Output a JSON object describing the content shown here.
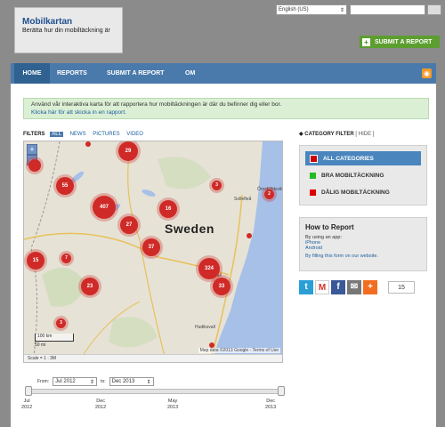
{
  "header": {
    "site_title": "Mobilkartan",
    "tagline": "Berätta hur din mobiltäckning är",
    "language": "English (US)",
    "submit_label": "SUBMIT A REPORT"
  },
  "nav": {
    "items": [
      "HOME",
      "REPORTS",
      "SUBMIT A REPORT",
      "OM"
    ]
  },
  "info": {
    "text": "Använd vår interaktiva karta för att rapportera hur mobiltäckningen är där du befinner dig eller bor.",
    "link": "Klicka här för att skicka in en rapport."
  },
  "filters": {
    "label": "FILTERS",
    "items": [
      "ALL",
      "NEWS",
      "PICTURES",
      "VIDEO"
    ]
  },
  "map": {
    "country_label": "Sweden",
    "clusters": [
      "29",
      "55",
      "407",
      "16",
      "27",
      "37",
      "15",
      "23",
      "324",
      "33"
    ],
    "small_counts": [
      "3",
      "7",
      "3",
      "2",
      "3"
    ],
    "towns": [
      "Sollefteå",
      "Örnsköldsvik",
      "Sundsvall",
      "Hudiksvall"
    ],
    "scale_km": "100 km",
    "scale_mi": "50 mi",
    "scale_ratio": "Scale = 1 : 3M",
    "attribution": "Map data ©2013 Google - Terms of Use"
  },
  "timeline": {
    "from_label": "From:",
    "from_value": "Jul 2012",
    "to_label": "to:",
    "to_value": "Dec 2013",
    "ticks": [
      {
        "month": "Jul",
        "year": "2012"
      },
      {
        "month": "Dec",
        "year": "2012"
      },
      {
        "month": "May",
        "year": "2013"
      },
      {
        "month": "Dec",
        "year": "2013"
      }
    ]
  },
  "sidebar": {
    "category_filter": "CATEGORY FILTER",
    "hide": "HIDE",
    "categories": [
      {
        "label": "ALL CATEGORIES",
        "color": "#cc0000"
      },
      {
        "label": "BRA MOBILTÄCKNING",
        "color": "#22bb22"
      },
      {
        "label": "DÅLIG MOBILTÄCKNING",
        "color": "#dd0000"
      }
    ],
    "howto_title": "How to Report",
    "howto_sub": "By using an app:",
    "howto_links": [
      "iPhone",
      "Android"
    ],
    "howto_form": "By filling this form on our website.",
    "share_count": "15"
  }
}
